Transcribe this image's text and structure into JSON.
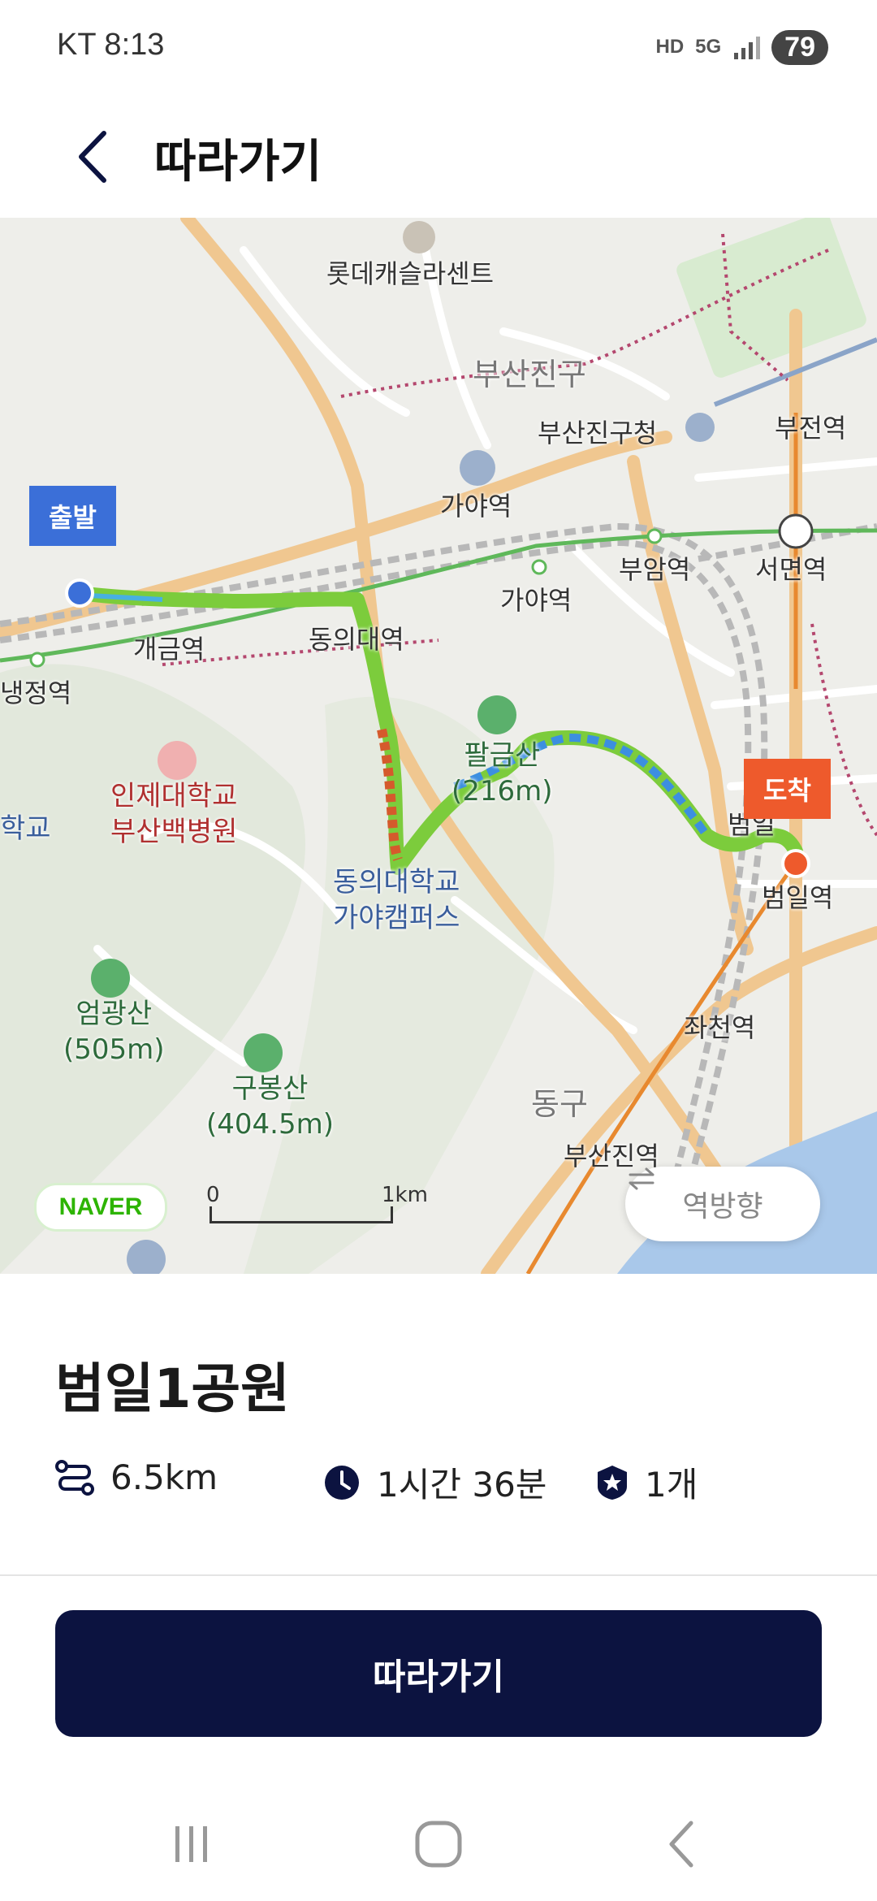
{
  "status": {
    "carrier_time": "KT 8:13",
    "icons": [
      "HD",
      "5G"
    ],
    "battery": "79"
  },
  "header": {
    "title": "따라가기"
  },
  "map": {
    "labels": {
      "lotte": "롯데캐슬라센트",
      "busanjingu": "부산진구",
      "busanjingu_office": "부산진구청",
      "bujeon": "부전역",
      "gaya_top": "가야역",
      "gaya_mid": "가야역",
      "buam": "부암역",
      "seomyeon": "서면역",
      "gaegeum": "개금역",
      "dongui_station": "동의대역",
      "naengjeong": "냉정역",
      "school_left": "학교",
      "inje_hospital_1": "인제대학교",
      "inje_hospital_2": "부산백병원",
      "palgeumsan_1": "팔금산",
      "palgeumsan_2": "(216m)",
      "dongeui_univ_1": "동의대학교",
      "dongeui_univ_2": "가야캠퍼스",
      "beomil_station": "범일역",
      "beomil_label": "범일",
      "eomgwangsan_1": "엄광산",
      "eomgwangsan_2": "(505m)",
      "gubongsan_1": "구봉산",
      "gubongsan_2": "(404.5m)",
      "jwacheon": "좌천역",
      "donggu": "동구",
      "busanjin": "부산진역"
    },
    "start_flag": "출발",
    "end_flag": "도착",
    "logo": "NAVER",
    "scale_start": "0",
    "scale_end": "1km",
    "reverse_button": "역방향"
  },
  "course": {
    "name": "범일1공원",
    "distance": "6.5km",
    "duration": "1시간 36분",
    "stamps": "1개"
  },
  "follow_button": "따라가기",
  "colors": {
    "accent": "#0c1340",
    "start": "#3b6fd8",
    "end": "#ee5a2c",
    "route": "#7ccc3c"
  }
}
